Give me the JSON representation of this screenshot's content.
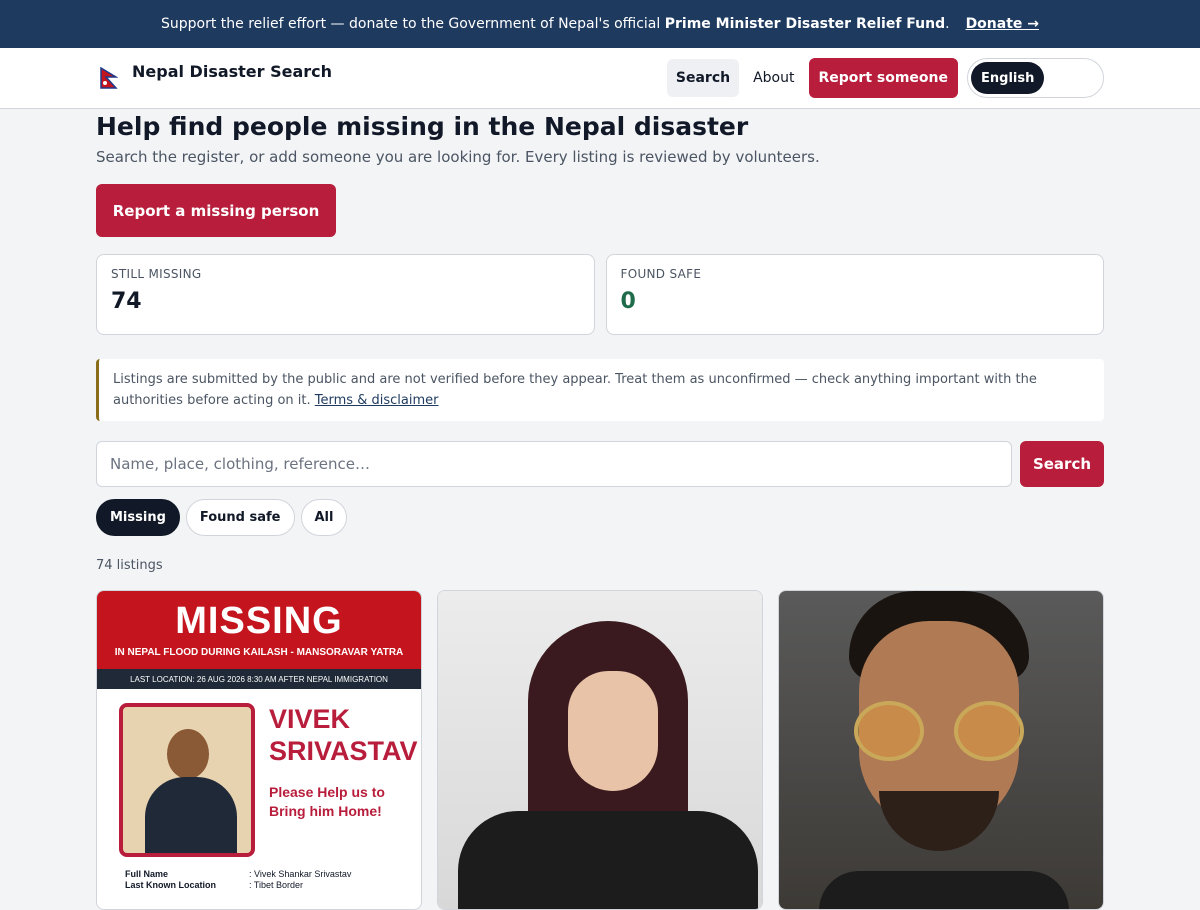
{
  "banner": {
    "text_before": "Support the relief effort — donate to the Government of Nepal's official ",
    "fund_name": "Prime Minister Disaster Relief Fund",
    "text_after": ".",
    "donate_label": "Donate →"
  },
  "header": {
    "brand": "Nepal Disaster Search",
    "nav": {
      "search": "Search",
      "about": "About",
      "report": "Report someone",
      "language": "English"
    }
  },
  "main": {
    "title": "Help find people missing in the Nepal disaster",
    "subtitle": "Search the register, or add someone you are looking for. Every listing is reviewed by volunteers.",
    "report_button": "Report a missing person"
  },
  "stats": {
    "missing_label": "STILL MISSING",
    "missing_value": "74",
    "found_label": "FOUND SAFE",
    "found_value": "0"
  },
  "notice": {
    "text": "Listings are submitted by the public and are not verified before they appear. Treat them as unconfirmed — check anything important with the authorities before acting on it. ",
    "link": "Terms & disclaimer"
  },
  "search": {
    "placeholder": "Name, place, clothing, reference…",
    "button": "Search"
  },
  "filters": [
    "Missing",
    "Found safe",
    "All"
  ],
  "listing_count": "74 listings",
  "cards": {
    "poster": {
      "title": "MISSING",
      "subtitle": "IN NEPAL FLOOD DURING KAILASH - MANSORAVAR YATRA",
      "strip": "LAST LOCATION:  26 AUG 2026  8:30 AM AFTER NEPAL IMMIGRATION",
      "name_line1": "VIVEK",
      "name_line2": "SRIVASTAV",
      "help_line1": "Please Help us to",
      "help_line2": "Bring him Home!",
      "details": [
        {
          "k": "Full Name",
          "v": ": Vivek Shankar Srivastav"
        },
        {
          "k": "Last Known Location",
          "v": ": Tibet Border"
        }
      ]
    }
  },
  "colors": {
    "banner_bg": "#1e3a5f",
    "accent_red": "#b81d3b",
    "found_green": "#1f6b4a"
  }
}
